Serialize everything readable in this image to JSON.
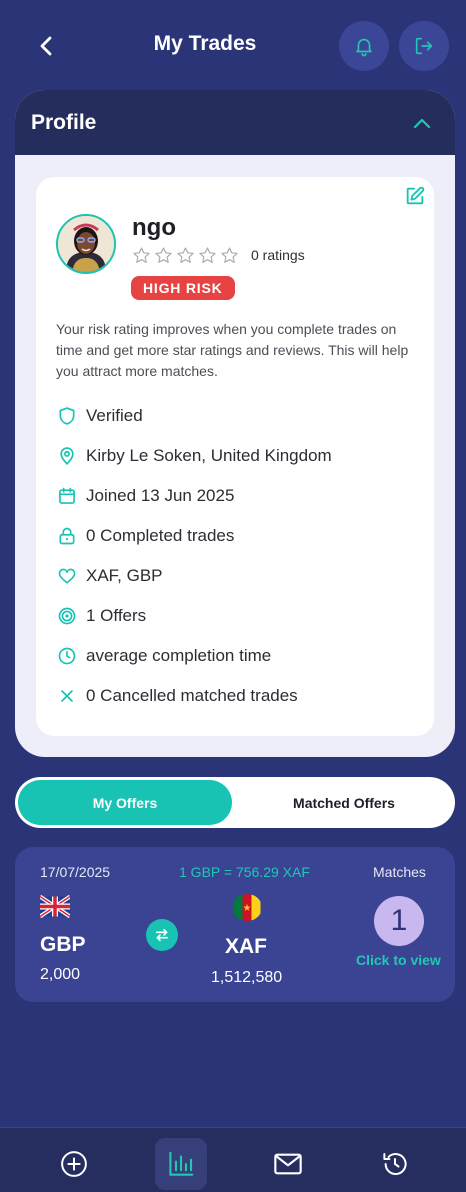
{
  "header": {
    "title": "My Trades",
    "back_icon": "chevron-left-icon",
    "bell_icon": "bell-icon",
    "logout_icon": "logout-icon"
  },
  "profile": {
    "section_title": "Profile",
    "username": "ngo",
    "rating": 0,
    "max_rating": 5,
    "ratings_text": "0 ratings",
    "risk_badge": "HIGH RISK",
    "risk_note": "Your risk rating improves when you complete trades on time and get more star ratings and reviews. This will help you attract more matches.",
    "details": [
      {
        "icon": "shield-icon",
        "text": "Verified"
      },
      {
        "icon": "location-pin-icon",
        "text": "Kirby Le Soken, United Kingdom"
      },
      {
        "icon": "calendar-icon",
        "text": "Joined 13 Jun 2025"
      },
      {
        "icon": "lock-icon",
        "text": "0 Completed trades"
      },
      {
        "icon": "heart-icon",
        "text": "XAF, GBP"
      },
      {
        "icon": "target-icon",
        "text": "1 Offers"
      },
      {
        "icon": "clock-icon",
        "text": "average completion time"
      },
      {
        "icon": "close-icon",
        "text": "0 Cancelled matched trades"
      }
    ]
  },
  "tabs": {
    "my_offers": "My Offers",
    "matched_offers": "Matched Offers",
    "active": "my_offers"
  },
  "offer": {
    "date": "17/07/2025",
    "rate": "1 GBP = 756.29 XAF",
    "matches_label": "Matches",
    "from_code": "GBP",
    "from_amount": "2,000",
    "to_code": "XAF",
    "to_amount": "1,512,580",
    "match_count": "1",
    "click_label": "Click to view"
  },
  "nav": {
    "items": [
      "plus-circle-icon",
      "bar-chart-icon",
      "mail-icon",
      "history-icon"
    ],
    "active": "bar-chart-icon"
  },
  "colors": {
    "background": "#2b3477",
    "accent": "#18c3b3",
    "danger": "#e84343",
    "card": "#ffffff"
  }
}
